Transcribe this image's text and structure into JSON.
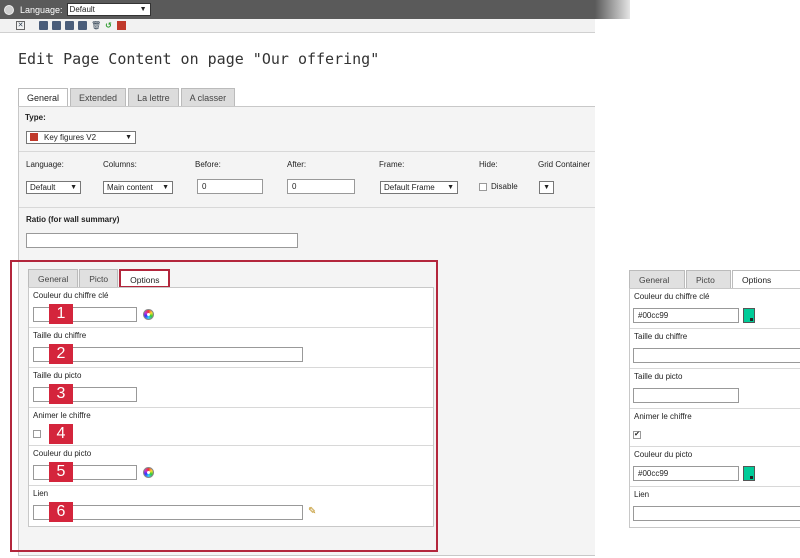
{
  "topbar": {
    "language_label": "Language:",
    "language_value": "Default"
  },
  "toolbar": {
    "icons": [
      "close-icon",
      "save-icon",
      "save-view-icon",
      "save-close-icon",
      "save-new-icon",
      "delete-icon",
      "undo-icon",
      "history-icon"
    ]
  },
  "page_title": "Edit Page Content on page \"Our offering\"",
  "main_tabs": [
    "General",
    "Extended",
    "La lettre",
    "A classer"
  ],
  "type": {
    "label": "Type:",
    "value": "Key figures V2"
  },
  "fields": {
    "language": {
      "label": "Language:",
      "value": "Default"
    },
    "columns": {
      "label": "Columns:",
      "value": "Main content"
    },
    "before": {
      "label": "Before:",
      "value": "0"
    },
    "after": {
      "label": "After:",
      "value": "0"
    },
    "frame": {
      "label": "Frame:",
      "value": "Default Frame"
    },
    "hide": {
      "label": "Hide:",
      "checkbox_label": "Disable"
    },
    "grid": {
      "label": "Grid Container",
      "value": ""
    }
  },
  "ratio": {
    "label": "Ratio (for wall summary)",
    "value": ""
  },
  "sub_tabs": [
    "General",
    "Picto",
    "Options"
  ],
  "options_left": [
    {
      "label": "Couleur du chiffre clé",
      "value": "",
      "badge": "1"
    },
    {
      "label": "Taille du chiffre",
      "value": "",
      "badge": "2"
    },
    {
      "label": "Taille du picto",
      "value": "",
      "badge": "3"
    },
    {
      "label": "Animer le chiffre",
      "value": "",
      "badge": "4"
    },
    {
      "label": "Couleur du picto",
      "value": "",
      "badge": "5"
    },
    {
      "label": "Lien",
      "value": "",
      "badge": "6"
    }
  ],
  "options_right": [
    {
      "label": "Couleur du chiffre clé",
      "value": "#00cc99"
    },
    {
      "label": "Taille du chiffre",
      "value": ""
    },
    {
      "label": "Taille du picto",
      "value": ""
    },
    {
      "label": "Animer le chiffre",
      "value": "✔"
    },
    {
      "label": "Couleur du picto",
      "value": "#00cc99"
    },
    {
      "label": "Lien",
      "value": ""
    }
  ],
  "colors": {
    "accent_red": "#d4253c",
    "swatch": "#00cc99"
  }
}
